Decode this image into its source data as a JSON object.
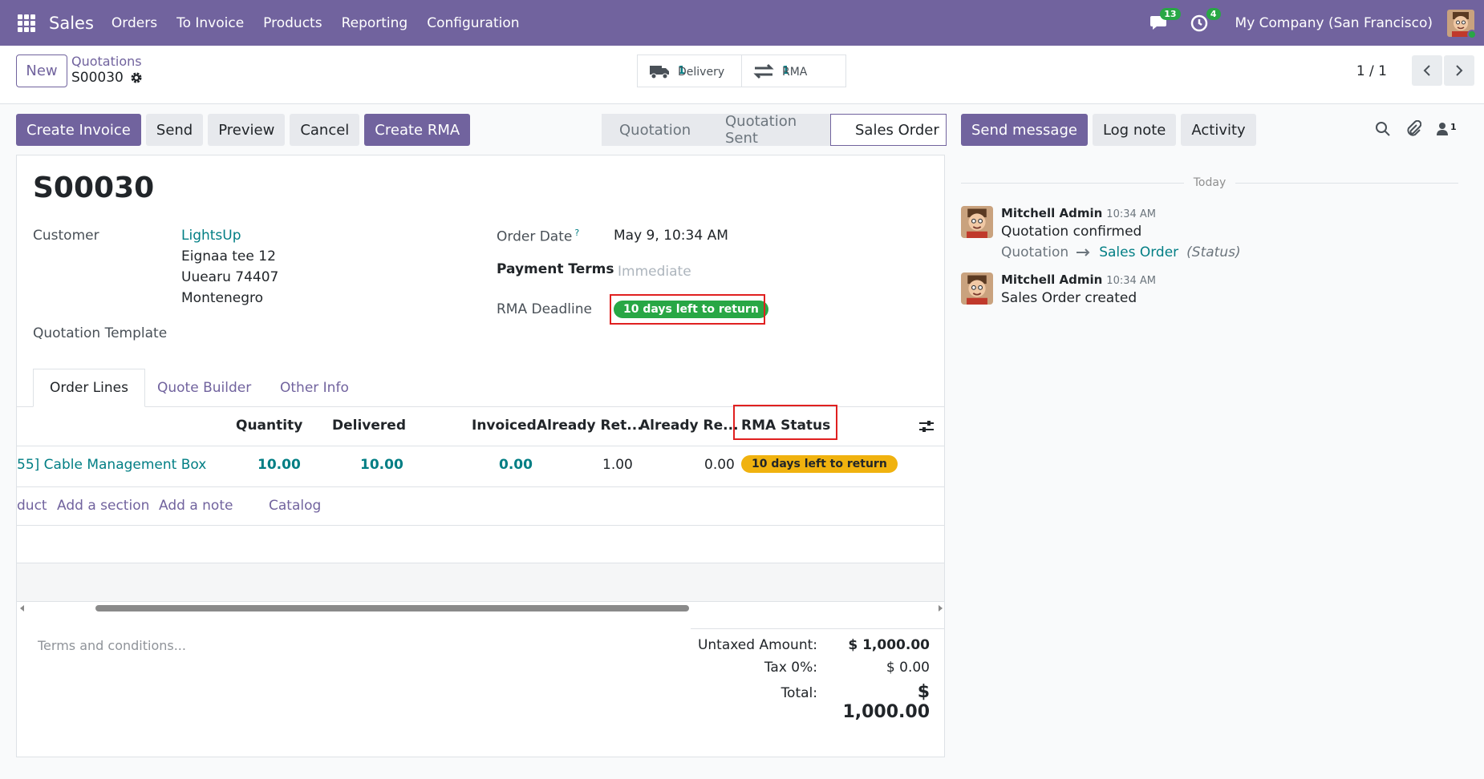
{
  "navbar": {
    "app": "Sales",
    "menus": [
      "Orders",
      "To Invoice",
      "Products",
      "Reporting",
      "Configuration"
    ],
    "messages_count": "13",
    "activities_count": "4",
    "company": "My Company (San Francisco)"
  },
  "control": {
    "new_label": "New",
    "breadcrumb_parent": "Quotations",
    "breadcrumb_current": "S00030",
    "smart_buttons": [
      {
        "label": "Delivery",
        "count": "1",
        "icon": "truck-icon"
      },
      {
        "label": "RMA",
        "count": "1",
        "icon": "exchange-icon"
      }
    ],
    "pager": "1 / 1"
  },
  "actions": {
    "create_invoice": "Create Invoice",
    "send": "Send",
    "preview": "Preview",
    "cancel": "Cancel",
    "create_rma": "Create RMA"
  },
  "statusbar": [
    "Quotation",
    "Quotation Sent",
    "Sales Order"
  ],
  "chatter": {
    "send_message": "Send message",
    "log_note": "Log note",
    "activity": "Activity",
    "followers_count": "1",
    "today": "Today",
    "messages": [
      {
        "author": "Mitchell Admin",
        "time": "10:34 AM",
        "text": "Quotation confirmed",
        "track_old": "Quotation",
        "track_new": "Sales Order",
        "track_field": "(Status)"
      },
      {
        "author": "Mitchell Admin",
        "time": "10:34 AM",
        "text": "Sales Order created"
      }
    ]
  },
  "form": {
    "title": "S00030",
    "customer_label": "Customer",
    "customer_name": "LightsUp",
    "address": [
      "Eignaa tee 12",
      "Uuearu 74407",
      "Montenegro"
    ],
    "quotation_template_label": "Quotation Template",
    "order_date_label": "Order Date",
    "order_date_help": "?",
    "order_date": "May 9, 10:34 AM",
    "payment_terms_label": "Payment Terms",
    "payment_terms_placeholder": "Immediate",
    "rma_deadline_label": "RMA Deadline",
    "rma_deadline_badge": "10 days left to return",
    "tabs": [
      "Order Lines",
      "Quote Builder",
      "Other Info"
    ],
    "columns": [
      "Quantity",
      "Delivered",
      "Invoiced",
      "Already Ret...",
      "Already Re...",
      "RMA Status"
    ],
    "line": {
      "product": "55] Cable Management Box",
      "quantity": "10.00",
      "delivered": "10.00",
      "invoiced": "0.00",
      "already_returned": "1.00",
      "already_refunded": "0.00",
      "rma_status": "10 days left to return"
    },
    "add_links": [
      "duct",
      "Add a section",
      "Add a note",
      "Catalog"
    ],
    "terms_placeholder": "Terms and conditions...",
    "totals": {
      "untaxed_label": "Untaxed Amount:",
      "untaxed": "$ 1,000.00",
      "tax_label": "Tax 0%:",
      "tax": "$ 0.00",
      "total_label": "Total:",
      "total": "$ 1,000.00"
    }
  },
  "colors": {
    "brand": "#71639e",
    "link": "#017e84",
    "success": "#28a745",
    "warning": "#f0b20f",
    "highlight": "#e02020"
  }
}
